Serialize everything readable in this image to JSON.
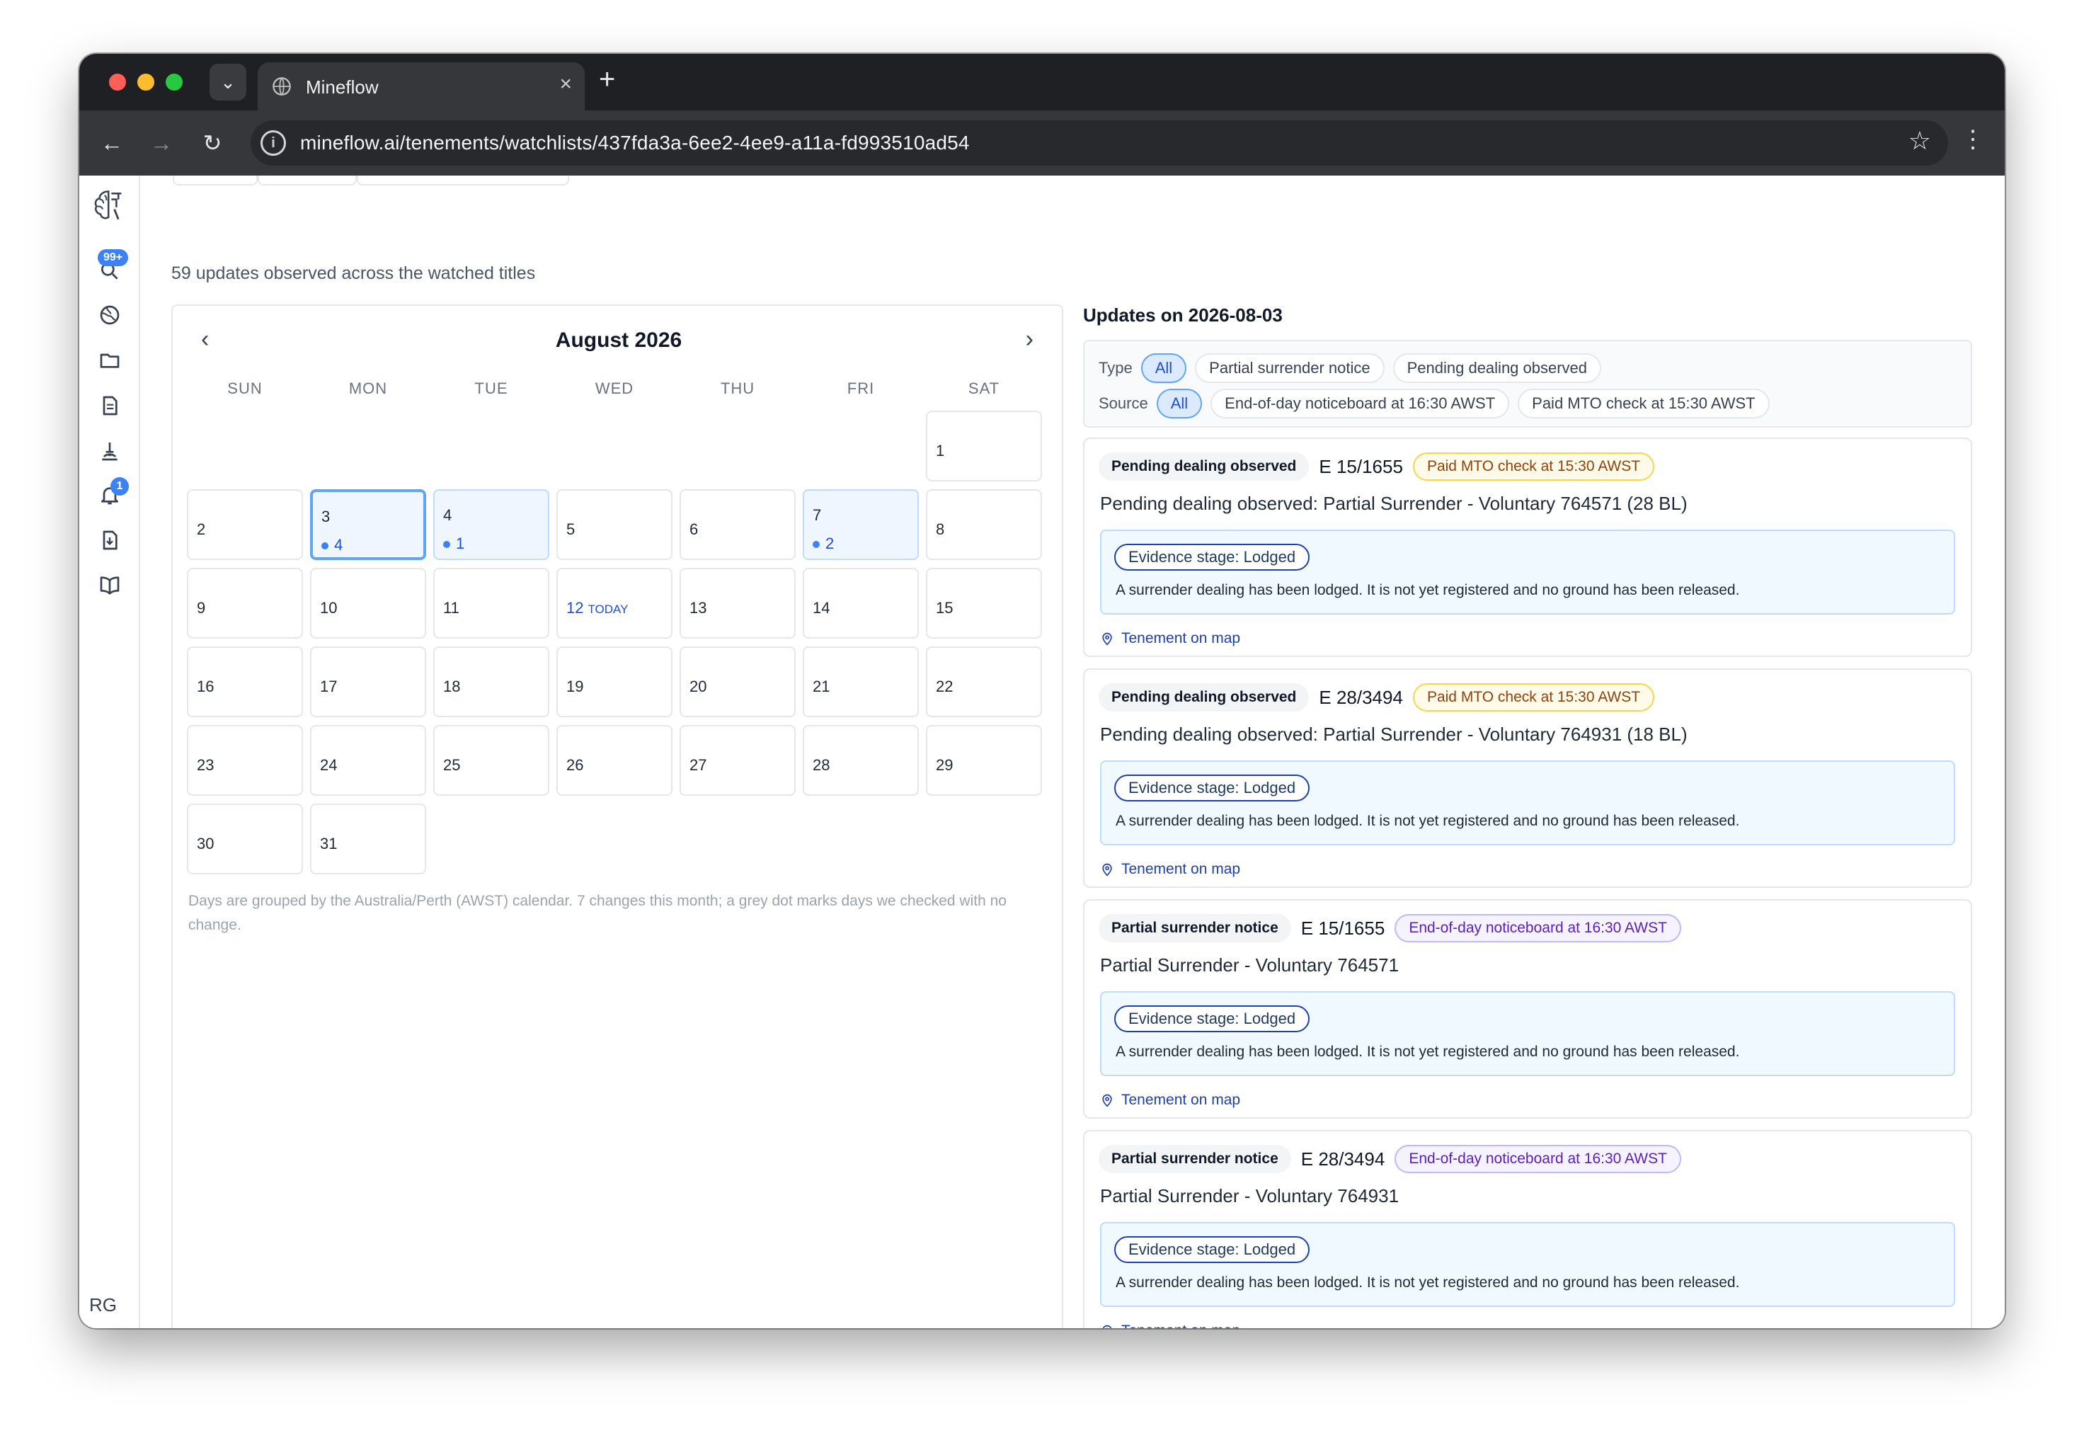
{
  "browser": {
    "tab_title": "Mineflow",
    "url": "mineflow.ai/tenements/watchlists/437fda3a-6ee2-4ee9-a11a-fd993510ad54"
  },
  "sidebar": {
    "notifications_badge": "99+",
    "alerts_badge": "1",
    "avatar": "RG"
  },
  "summary": "59 updates observed across the watched titles",
  "calendar": {
    "month_label": "August 2026",
    "weekdays": [
      "SUN",
      "MON",
      "TUE",
      "WED",
      "THU",
      "FRI",
      "SAT"
    ],
    "days": [
      {
        "day": "1",
        "count": ""
      },
      {
        "day": "2",
        "count": ""
      },
      {
        "day": "3",
        "count": "4"
      },
      {
        "day": "4",
        "count": "1"
      },
      {
        "day": "5",
        "count": ""
      },
      {
        "day": "6",
        "count": ""
      },
      {
        "day": "7",
        "count": "2"
      },
      {
        "day": "8",
        "count": ""
      },
      {
        "day": "9",
        "count": ""
      },
      {
        "day": "10",
        "count": ""
      },
      {
        "day": "11",
        "count": ""
      },
      {
        "day": "12",
        "count": ""
      },
      {
        "day": "13",
        "count": ""
      },
      {
        "day": "14",
        "count": ""
      },
      {
        "day": "15",
        "count": ""
      },
      {
        "day": "16",
        "count": ""
      },
      {
        "day": "17",
        "count": ""
      },
      {
        "day": "18",
        "count": ""
      },
      {
        "day": "19",
        "count": ""
      },
      {
        "day": "20",
        "count": ""
      },
      {
        "day": "21",
        "count": ""
      },
      {
        "day": "22",
        "count": ""
      },
      {
        "day": "23",
        "count": ""
      },
      {
        "day": "24",
        "count": ""
      },
      {
        "day": "25",
        "count": ""
      },
      {
        "day": "26",
        "count": ""
      },
      {
        "day": "27",
        "count": ""
      },
      {
        "day": "28",
        "count": ""
      },
      {
        "day": "29",
        "count": ""
      },
      {
        "day": "30",
        "count": ""
      },
      {
        "day": "31",
        "count": ""
      }
    ],
    "today_label": "TODAY",
    "note": "Days are grouped by the Australia/Perth (AWST) calendar. 7 changes this month; a grey dot marks days we checked with no change."
  },
  "updates": {
    "title": "Updates on 2026-08-03",
    "type_label": "Type",
    "type_options": [
      "All",
      "Partial surrender notice",
      "Pending dealing observed"
    ],
    "source_label": "Source",
    "source_options": [
      "All",
      "End-of-day noticeboard at 16:30 AWST",
      "Paid MTO check at 15:30 AWST"
    ],
    "items": [
      {
        "type": "Pending dealing observed",
        "tenement": "E 15/1655",
        "source": "Paid MTO check at 15:30 AWST",
        "title": "Pending dealing observed: Partial Surrender - Voluntary 764571 (28 BL)",
        "stage": "Evidence stage: Lodged",
        "detail": "A surrender dealing has been lodged. It is not yet registered and no ground has been released.",
        "link": "Tenement on map"
      },
      {
        "type": "Pending dealing observed",
        "tenement": "E 28/3494",
        "source": "Paid MTO check at 15:30 AWST",
        "title": "Pending dealing observed: Partial Surrender - Voluntary 764931 (18 BL)",
        "stage": "Evidence stage: Lodged",
        "detail": "A surrender dealing has been lodged. It is not yet registered and no ground has been released.",
        "link": "Tenement on map"
      },
      {
        "type": "Partial surrender notice",
        "tenement": "E 15/1655",
        "source": "End-of-day noticeboard at 16:30 AWST",
        "title": "Partial Surrender - Voluntary 764571",
        "stage": "Evidence stage: Lodged",
        "detail": "A surrender dealing has been lodged. It is not yet registered and no ground has been released.",
        "link": "Tenement on map"
      },
      {
        "type": "Partial surrender notice",
        "tenement": "E 28/3494",
        "source": "End-of-day noticeboard at 16:30 AWST",
        "title": "Partial Surrender - Voluntary 764931",
        "stage": "Evidence stage: Lodged",
        "detail": "A surrender dealing has been lodged. It is not yet registered and no ground has been released.",
        "link": "Tenement on map"
      }
    ]
  },
  "colors": {
    "accent": "#3b82f6",
    "mto_badge": "#92400e",
    "noticeboard_badge": "#5b21b6"
  }
}
